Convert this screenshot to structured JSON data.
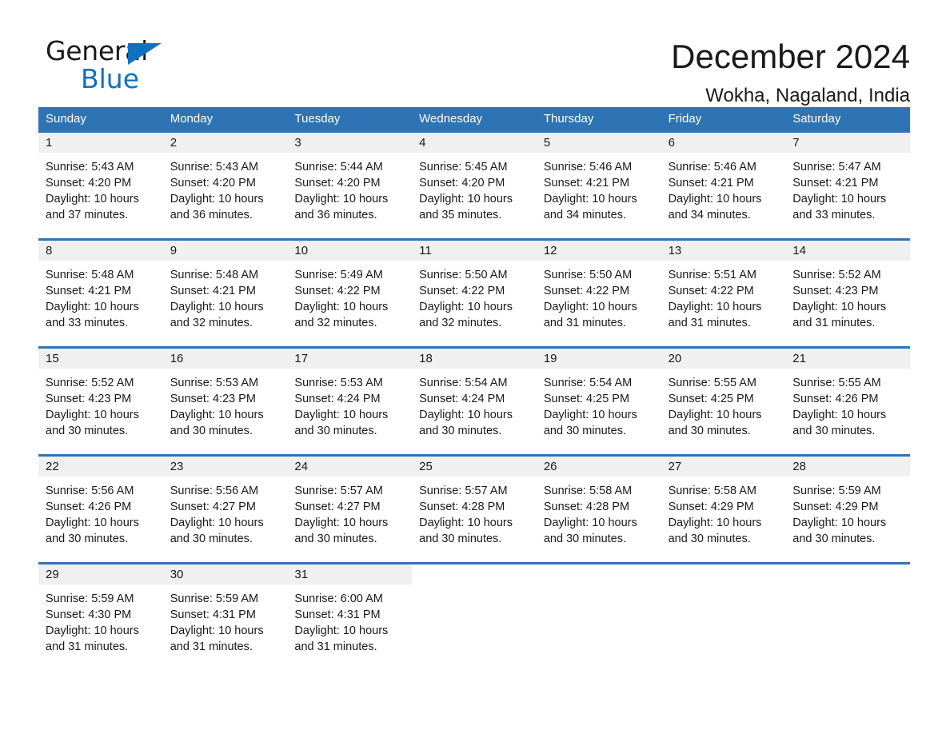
{
  "logo": {
    "word_one": "General",
    "word_two": "Blue",
    "triangle_icon": "triangle-icon",
    "accent_color": "#1271be"
  },
  "header": {
    "title": "December 2024",
    "subtitle": "Wokha, Nagaland, India"
  },
  "theme": {
    "header_blue": "#2e74b5",
    "daynum_band": "#f0f0f0",
    "text": "#1a1a1a"
  },
  "weekdays": [
    "Sunday",
    "Monday",
    "Tuesday",
    "Wednesday",
    "Thursday",
    "Friday",
    "Saturday"
  ],
  "weeks": [
    [
      {
        "day": "1",
        "sunrise": "Sunrise: 5:43 AM",
        "sunset": "Sunset: 4:20 PM",
        "daylight_1": "Daylight: 10 hours",
        "daylight_2": "and 37 minutes."
      },
      {
        "day": "2",
        "sunrise": "Sunrise: 5:43 AM",
        "sunset": "Sunset: 4:20 PM",
        "daylight_1": "Daylight: 10 hours",
        "daylight_2": "and 36 minutes."
      },
      {
        "day": "3",
        "sunrise": "Sunrise: 5:44 AM",
        "sunset": "Sunset: 4:20 PM",
        "daylight_1": "Daylight: 10 hours",
        "daylight_2": "and 36 minutes."
      },
      {
        "day": "4",
        "sunrise": "Sunrise: 5:45 AM",
        "sunset": "Sunset: 4:20 PM",
        "daylight_1": "Daylight: 10 hours",
        "daylight_2": "and 35 minutes."
      },
      {
        "day": "5",
        "sunrise": "Sunrise: 5:46 AM",
        "sunset": "Sunset: 4:21 PM",
        "daylight_1": "Daylight: 10 hours",
        "daylight_2": "and 34 minutes."
      },
      {
        "day": "6",
        "sunrise": "Sunrise: 5:46 AM",
        "sunset": "Sunset: 4:21 PM",
        "daylight_1": "Daylight: 10 hours",
        "daylight_2": "and 34 minutes."
      },
      {
        "day": "7",
        "sunrise": "Sunrise: 5:47 AM",
        "sunset": "Sunset: 4:21 PM",
        "daylight_1": "Daylight: 10 hours",
        "daylight_2": "and 33 minutes."
      }
    ],
    [
      {
        "day": "8",
        "sunrise": "Sunrise: 5:48 AM",
        "sunset": "Sunset: 4:21 PM",
        "daylight_1": "Daylight: 10 hours",
        "daylight_2": "and 33 minutes."
      },
      {
        "day": "9",
        "sunrise": "Sunrise: 5:48 AM",
        "sunset": "Sunset: 4:21 PM",
        "daylight_1": "Daylight: 10 hours",
        "daylight_2": "and 32 minutes."
      },
      {
        "day": "10",
        "sunrise": "Sunrise: 5:49 AM",
        "sunset": "Sunset: 4:22 PM",
        "daylight_1": "Daylight: 10 hours",
        "daylight_2": "and 32 minutes."
      },
      {
        "day": "11",
        "sunrise": "Sunrise: 5:50 AM",
        "sunset": "Sunset: 4:22 PM",
        "daylight_1": "Daylight: 10 hours",
        "daylight_2": "and 32 minutes."
      },
      {
        "day": "12",
        "sunrise": "Sunrise: 5:50 AM",
        "sunset": "Sunset: 4:22 PM",
        "daylight_1": "Daylight: 10 hours",
        "daylight_2": "and 31 minutes."
      },
      {
        "day": "13",
        "sunrise": "Sunrise: 5:51 AM",
        "sunset": "Sunset: 4:22 PM",
        "daylight_1": "Daylight: 10 hours",
        "daylight_2": "and 31 minutes."
      },
      {
        "day": "14",
        "sunrise": "Sunrise: 5:52 AM",
        "sunset": "Sunset: 4:23 PM",
        "daylight_1": "Daylight: 10 hours",
        "daylight_2": "and 31 minutes."
      }
    ],
    [
      {
        "day": "15",
        "sunrise": "Sunrise: 5:52 AM",
        "sunset": "Sunset: 4:23 PM",
        "daylight_1": "Daylight: 10 hours",
        "daylight_2": "and 30 minutes."
      },
      {
        "day": "16",
        "sunrise": "Sunrise: 5:53 AM",
        "sunset": "Sunset: 4:23 PM",
        "daylight_1": "Daylight: 10 hours",
        "daylight_2": "and 30 minutes."
      },
      {
        "day": "17",
        "sunrise": "Sunrise: 5:53 AM",
        "sunset": "Sunset: 4:24 PM",
        "daylight_1": "Daylight: 10 hours",
        "daylight_2": "and 30 minutes."
      },
      {
        "day": "18",
        "sunrise": "Sunrise: 5:54 AM",
        "sunset": "Sunset: 4:24 PM",
        "daylight_1": "Daylight: 10 hours",
        "daylight_2": "and 30 minutes."
      },
      {
        "day": "19",
        "sunrise": "Sunrise: 5:54 AM",
        "sunset": "Sunset: 4:25 PM",
        "daylight_1": "Daylight: 10 hours",
        "daylight_2": "and 30 minutes."
      },
      {
        "day": "20",
        "sunrise": "Sunrise: 5:55 AM",
        "sunset": "Sunset: 4:25 PM",
        "daylight_1": "Daylight: 10 hours",
        "daylight_2": "and 30 minutes."
      },
      {
        "day": "21",
        "sunrise": "Sunrise: 5:55 AM",
        "sunset": "Sunset: 4:26 PM",
        "daylight_1": "Daylight: 10 hours",
        "daylight_2": "and 30 minutes."
      }
    ],
    [
      {
        "day": "22",
        "sunrise": "Sunrise: 5:56 AM",
        "sunset": "Sunset: 4:26 PM",
        "daylight_1": "Daylight: 10 hours",
        "daylight_2": "and 30 minutes."
      },
      {
        "day": "23",
        "sunrise": "Sunrise: 5:56 AM",
        "sunset": "Sunset: 4:27 PM",
        "daylight_1": "Daylight: 10 hours",
        "daylight_2": "and 30 minutes."
      },
      {
        "day": "24",
        "sunrise": "Sunrise: 5:57 AM",
        "sunset": "Sunset: 4:27 PM",
        "daylight_1": "Daylight: 10 hours",
        "daylight_2": "and 30 minutes."
      },
      {
        "day": "25",
        "sunrise": "Sunrise: 5:57 AM",
        "sunset": "Sunset: 4:28 PM",
        "daylight_1": "Daylight: 10 hours",
        "daylight_2": "and 30 minutes."
      },
      {
        "day": "26",
        "sunrise": "Sunrise: 5:58 AM",
        "sunset": "Sunset: 4:28 PM",
        "daylight_1": "Daylight: 10 hours",
        "daylight_2": "and 30 minutes."
      },
      {
        "day": "27",
        "sunrise": "Sunrise: 5:58 AM",
        "sunset": "Sunset: 4:29 PM",
        "daylight_1": "Daylight: 10 hours",
        "daylight_2": "and 30 minutes."
      },
      {
        "day": "28",
        "sunrise": "Sunrise: 5:59 AM",
        "sunset": "Sunset: 4:29 PM",
        "daylight_1": "Daylight: 10 hours",
        "daylight_2": "and 30 minutes."
      }
    ],
    [
      {
        "day": "29",
        "sunrise": "Sunrise: 5:59 AM",
        "sunset": "Sunset: 4:30 PM",
        "daylight_1": "Daylight: 10 hours",
        "daylight_2": "and 31 minutes."
      },
      {
        "day": "30",
        "sunrise": "Sunrise: 5:59 AM",
        "sunset": "Sunset: 4:31 PM",
        "daylight_1": "Daylight: 10 hours",
        "daylight_2": "and 31 minutes."
      },
      {
        "day": "31",
        "sunrise": "Sunrise: 6:00 AM",
        "sunset": "Sunset: 4:31 PM",
        "daylight_1": "Daylight: 10 hours",
        "daylight_2": "and 31 minutes."
      },
      {
        "day": "",
        "sunrise": "",
        "sunset": "",
        "daylight_1": "",
        "daylight_2": ""
      },
      {
        "day": "",
        "sunrise": "",
        "sunset": "",
        "daylight_1": "",
        "daylight_2": ""
      },
      {
        "day": "",
        "sunrise": "",
        "sunset": "",
        "daylight_1": "",
        "daylight_2": ""
      },
      {
        "day": "",
        "sunrise": "",
        "sunset": "",
        "daylight_1": "",
        "daylight_2": ""
      }
    ]
  ]
}
